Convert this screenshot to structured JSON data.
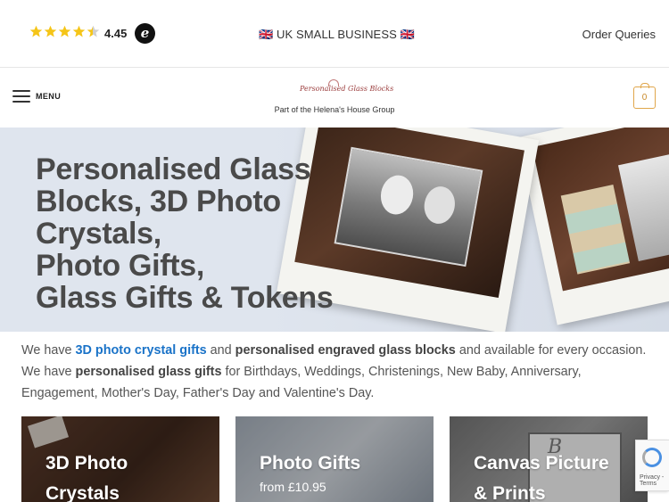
{
  "topbar": {
    "rating_value": "4.45",
    "rating_stars": 4.45,
    "trust_logo_letter": "e",
    "promo_text": "🇬🇧 UK SMALL BUSINESS 🇬🇧",
    "order_link": "Order Queries",
    "star_color": "#f5c518"
  },
  "header": {
    "menu_label": "MENU",
    "logo_text": "Personalised Glass Blocks",
    "tagline": "Part of the Helena's House Group",
    "cart_count": "0",
    "accent_color": "#e0a64b"
  },
  "hero": {
    "title_lines": [
      "Personalised Glass",
      "Blocks, 3D Photo",
      "Crystals,",
      "Photo Gifts,",
      "Glass Gifts & Tokens"
    ]
  },
  "intro": {
    "p1_a": "We have ",
    "p1_link1": "3D photo crystal gifts",
    "p1_b": " and ",
    "p1_bold1": "personalised engraved glass blocks",
    "p1_c": " and available for every occasion.",
    "p2_a": "We have ",
    "p2_bold": "personalised glass gifts",
    "p2_b": " for Birthdays, Weddings, Christenings, New Baby, Anniversary, Engagement, Mother's Day, Father's Day and Valentine's Day.",
    "link_color": "#1a73c8"
  },
  "cards": [
    {
      "title_line1": "3D Photo",
      "title_line2": "Crystals",
      "subtitle": ""
    },
    {
      "title_line1": "Photo Gifts",
      "title_line2": "",
      "subtitle": "from £10.95"
    },
    {
      "title_line1": "Canvas Picture",
      "title_line2": "& Prints",
      "subtitle": "",
      "canvas_word": "B"
    }
  ],
  "recaptcha": {
    "text": "Privacy - Terms"
  }
}
